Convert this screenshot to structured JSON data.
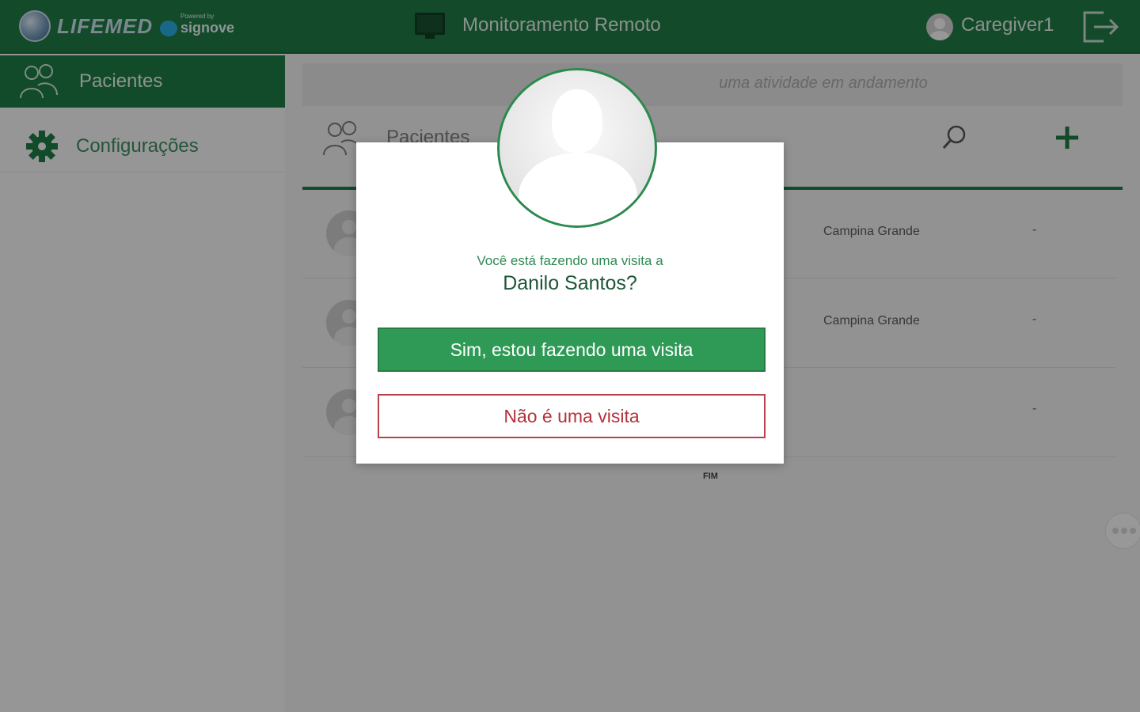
{
  "header": {
    "logo_text": "LIFEMED",
    "powered_by": "Powered by",
    "powered_name": "signove",
    "app_title": "Monitoramento Remoto",
    "user_name": "Caregiver1"
  },
  "sidebar": {
    "items": [
      {
        "label": "Pacientes",
        "active": true
      },
      {
        "label": "Configurações",
        "active": false
      }
    ]
  },
  "main": {
    "activity_text": "uma atividade em andamento",
    "panel_title": "Pacientes",
    "rows": [
      {
        "city": "Campina Grande",
        "value": "-"
      },
      {
        "city": "Campina Grande",
        "value": "-"
      },
      {
        "city": "",
        "value": "-"
      }
    ],
    "end_label": "FIM"
  },
  "modal": {
    "question": "Você está fazendo uma visita a",
    "patient_name": "Danilo Santos?",
    "confirm_label": "Sim, estou fazendo uma visita",
    "deny_label": "Não é uma visita"
  },
  "colors": {
    "brand_green": "#1f7a45",
    "confirm_green": "#2e9a55",
    "deny_red": "#b3323b"
  }
}
